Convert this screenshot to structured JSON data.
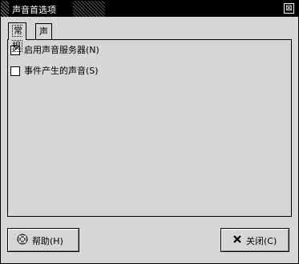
{
  "window": {
    "title": "声音首选项",
    "close_glyph": "⊠"
  },
  "tabs": [
    {
      "label": "常规",
      "active": true
    },
    {
      "label": "声音事件",
      "active": false
    }
  ],
  "options": [
    {
      "label": "启用声音服务器(N)",
      "checked": true,
      "check_glyph": "✓"
    },
    {
      "label": "事件产生的声音(S)",
      "checked": false,
      "check_glyph": ""
    }
  ],
  "buttons": {
    "help": {
      "label": "帮助(H)",
      "icon": "lifebuoy-icon"
    },
    "close": {
      "label": "关闭(C)",
      "icon": "close-x-icon"
    }
  },
  "colors": {
    "window_bg": "#d6d6d6",
    "titlebar_bg": "#000000"
  }
}
